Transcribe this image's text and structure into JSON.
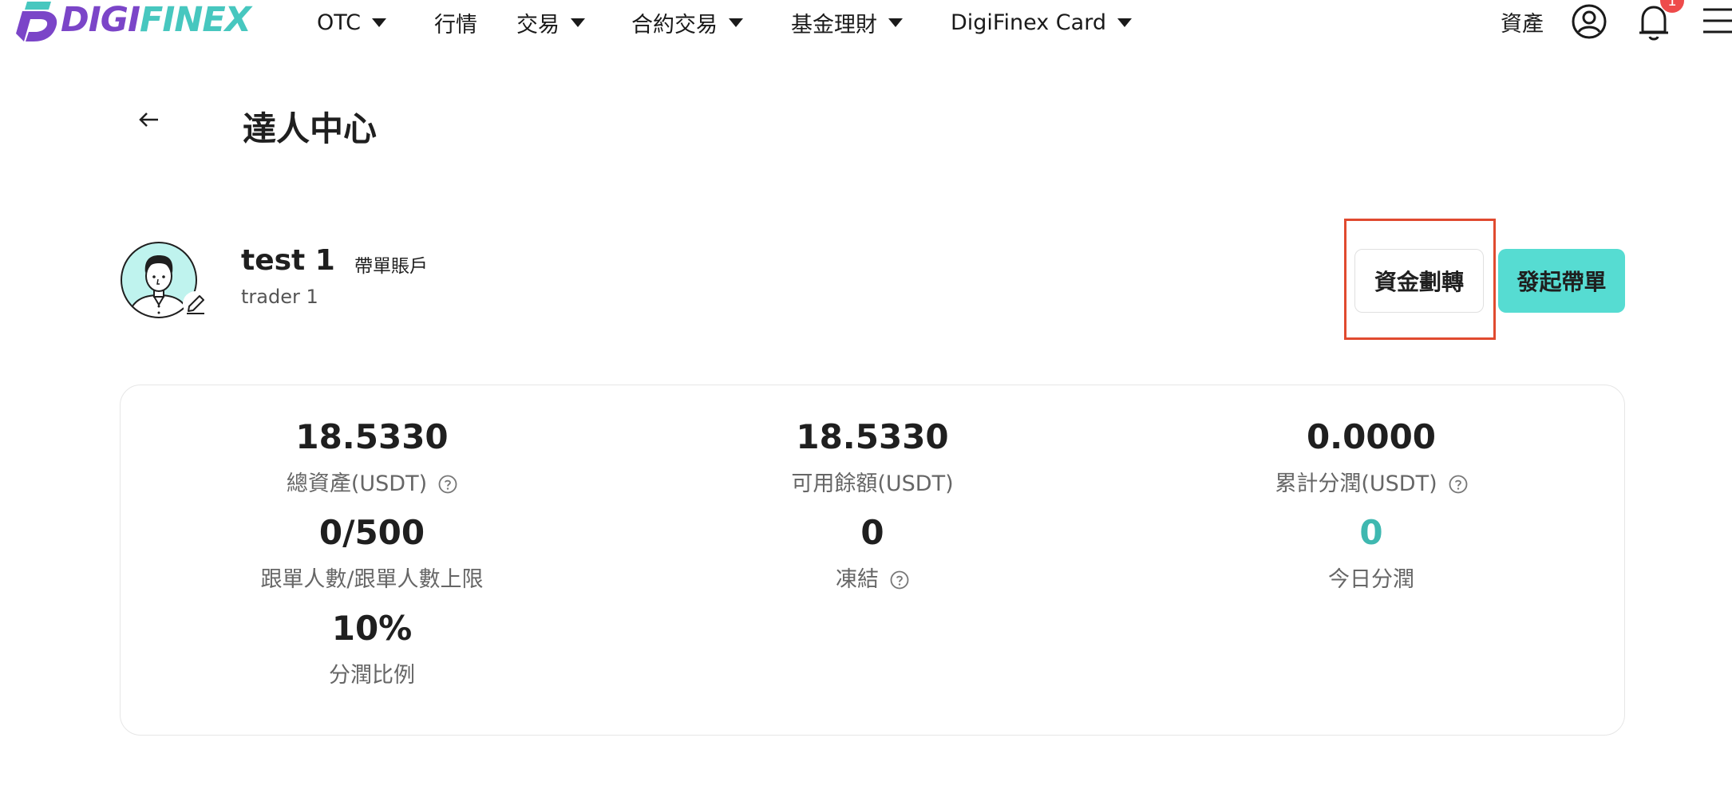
{
  "header": {
    "logo_text": "DIGIFINEX",
    "nav": [
      {
        "label": "OTC",
        "has_dropdown": true
      },
      {
        "label": "行情",
        "has_dropdown": false
      },
      {
        "label": "交易",
        "has_dropdown": true
      },
      {
        "label": "合約交易",
        "has_dropdown": true
      },
      {
        "label": "基金理財",
        "has_dropdown": true
      },
      {
        "label": "DigiFinex Card",
        "has_dropdown": true
      }
    ],
    "assets_label": "資產",
    "notification_count": "1",
    "icons": [
      "user-icon",
      "bell-icon",
      "menu-icon"
    ]
  },
  "page": {
    "title": "達人中心"
  },
  "profile": {
    "name": "test 1",
    "tag": "帶單賬戶",
    "subtitle": "trader 1"
  },
  "actions": {
    "transfer_label": "資金劃轉",
    "start_label": "發起帶單"
  },
  "stats": {
    "total_assets": {
      "value": "18.5330",
      "label": "總資產(USDT)"
    },
    "available": {
      "value": "18.5330",
      "label": "可用餘額(USDT)"
    },
    "cumulative_profit": {
      "value": "0.0000",
      "label": "累計分潤(USDT)"
    },
    "followers": {
      "value": "0/500",
      "label": "跟單人數/跟單人數上限"
    },
    "frozen": {
      "value": "0",
      "label": "凍結"
    },
    "today_profit": {
      "value": "0",
      "label": "今日分潤"
    },
    "profit_ratio": {
      "value": "10%",
      "label": "分潤比例"
    }
  },
  "colors": {
    "brand_purple": "#7b45c8",
    "brand_teal": "#47c7bf",
    "accent_button": "#56dcd2",
    "highlight_border": "#e04a2f",
    "badge": "#ee4b4b",
    "teal_value": "#3fb8b0"
  }
}
